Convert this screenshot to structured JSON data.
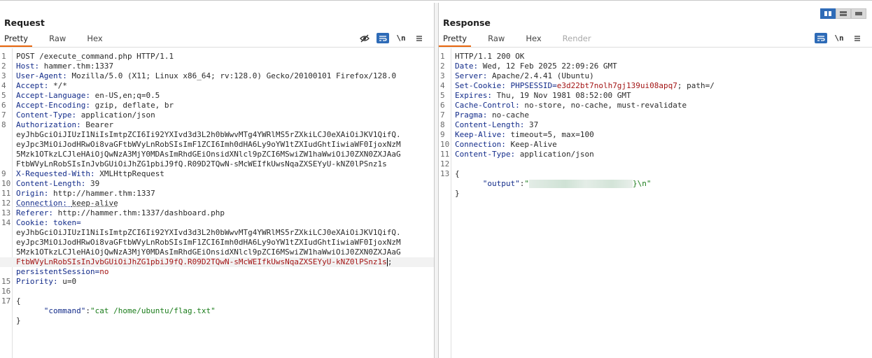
{
  "request": {
    "title": "Request",
    "tabs": [
      {
        "label": "Pretty",
        "active": true
      },
      {
        "label": "Raw"
      },
      {
        "label": "Hex"
      }
    ],
    "icons": [
      "eye-slash-icon",
      "wrap-icon",
      "newline-icon",
      "menu-icon"
    ],
    "newline_label": "\\n",
    "line_numbers": [
      "1",
      "2",
      "3",
      "4",
      "5",
      "6",
      "7",
      "8",
      "9",
      "10",
      "11",
      "12",
      "13",
      "14",
      "15",
      "16",
      "17"
    ],
    "request_line": "POST /execute_command.php HTTP/1.1",
    "headers": [
      {
        "name": "Host",
        "value": "hammer.thm:1337"
      },
      {
        "name": "User-Agent",
        "value": "Mozilla/5.0 (X11; Linux x86_64; rv:128.0) Gecko/20100101 Firefox/128.0"
      },
      {
        "name": "Accept",
        "value": "*/*"
      },
      {
        "name": "Accept-Language",
        "value": "en-US,en;q=0.5"
      },
      {
        "name": "Accept-Encoding",
        "value": "gzip, deflate, br"
      },
      {
        "name": "Content-Type",
        "value": "application/json"
      },
      {
        "name": "Authorization",
        "value": "Bearer"
      }
    ],
    "auth_token_lines": [
      "eyJhbGciOiJIUzI1NiIsImtpZCI6Ii92YXIvd3d3L2h0bWwvMTg4YWRlMS5rZXkiLCJ0eXAiOiJKV1QifQ.",
      "eyJpc3MiOiJodHRwOi8vaGFtbWVyLnRobSIsImF1ZCI6Imh0dHA6Ly9oYW1tZXIudGhtIiwiaWF0IjoxNzM",
      "5Mzk1OTkzLCJleHAiOjQwNzA3MjY0MDAsImRhdGEiOnsidXNlcl9pZCI6MSwiZW1haWwiOiJ0ZXN0ZXJAaG",
      "FtbWVyLnRobSIsInJvbGUiOiJhZG1pbiJ9fQ.R09D2TQwN-sMcWEIfkUwsNqaZXSEYyU-kNZ0lPSnz1s"
    ],
    "headers2": [
      {
        "name": "X-Requested-With",
        "value": "XMLHttpRequest"
      },
      {
        "name": "Content-Length",
        "value": "39"
      },
      {
        "name": "Origin",
        "value": "http://hammer.thm:1337"
      },
      {
        "name": "Connection",
        "value": "keep-alive"
      },
      {
        "name": "Referer",
        "value": "http://hammer.thm:1337/dashboard.php"
      }
    ],
    "cookie_label": "Cookie",
    "cookie_token_name": "token",
    "cookie_token_lines": [
      "eyJhbGciOiJIUzI1NiIsImtpZCI6Ii92YXIvd3d3L2h0bWwvMTg4YWRlMS5rZXkiLCJ0eXAiOiJKV1QifQ.",
      "eyJpc3MiOiJodHRwOi8vaGFtbWVyLnRobSIsImF1ZCI6Imh0dHA6Ly9oYW1tZXIudGhtIiwiaWF0IjoxNzM",
      "5Mzk1OTkzLCJleHAiOjQwNzA3MjY0MDAsImRhdGEiOnsidXNlcl9pZCI6MSwiZW1haWwiOiJ0ZXN0ZXJAaG",
      "FtbWVyLnRobSIsInJvbGUiOiJhZG1pbiJ9fQ.R09D2TQwN-sMcWEIfkUwsNqaZXSEYyU-kNZ0lPSnz1s"
    ],
    "cookie_sep": ";",
    "cookie2_name": "persistentSession",
    "cookie2_value": "no",
    "priority": {
      "name": "Priority",
      "value": "u=0"
    },
    "body_open": "{",
    "body_key": "\"command\"",
    "body_colon": ":",
    "body_value": "\"cat /home/ubuntu/flag.txt\"",
    "body_close": "}"
  },
  "response": {
    "title": "Response",
    "tabs": [
      {
        "label": "Pretty",
        "active": true
      },
      {
        "label": "Raw"
      },
      {
        "label": "Hex"
      },
      {
        "label": "Render",
        "disabled": true
      }
    ],
    "icons": [
      "wrap-icon",
      "newline-icon",
      "menu-icon"
    ],
    "newline_label": "\\n",
    "line_numbers": [
      "1",
      "2",
      "3",
      "4",
      "5",
      "6",
      "7",
      "8",
      "9",
      "10",
      "11",
      "12",
      "13"
    ],
    "status_line": "HTTP/1.1 200 OK",
    "headers": [
      {
        "name": "Date",
        "value": "Wed, 12 Feb 2025 22:09:26 GMT"
      },
      {
        "name": "Server",
        "value": "Apache/2.4.41 (Ubuntu)"
      }
    ],
    "set_cookie_label": "Set-Cookie",
    "set_cookie_name": "PHPSESSID",
    "set_cookie_eq": "=",
    "set_cookie_value": "e3d22bt7nolh7gj139ui08apq7",
    "set_cookie_rest": "; path=/",
    "headers2": [
      {
        "name": "Expires",
        "value": "Thu, 19 Nov 1981 08:52:00 GMT"
      },
      {
        "name": "Cache-Control",
        "value": "no-store, no-cache, must-revalidate"
      },
      {
        "name": "Pragma",
        "value": "no-cache"
      },
      {
        "name": "Content-Length",
        "value": "37"
      },
      {
        "name": "Keep-Alive",
        "value": "timeout=5, max=100"
      },
      {
        "name": "Connection",
        "value": "Keep-Alive"
      },
      {
        "name": "Content-Type",
        "value": "application/json"
      }
    ],
    "body_open": "{",
    "body_key": "\"output\"",
    "body_colon": ":",
    "body_value_prefix": "\"",
    "body_value_suffix": "}\\n\"",
    "body_close": "}"
  },
  "view_toggle": {
    "options": [
      "split-horizontal",
      "split-vertical",
      "tabs"
    ],
    "active": "split-horizontal"
  },
  "colors": {
    "accent": "#e8660d",
    "header_name": "#132c8a",
    "string_red": "#a31515",
    "string_green": "#1a7c1a",
    "blue_button": "#2e6bb7"
  }
}
